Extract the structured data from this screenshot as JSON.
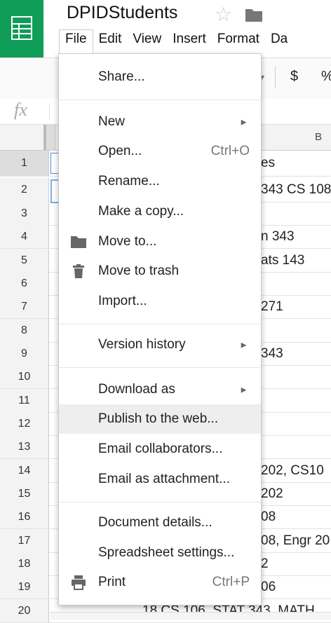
{
  "app": {
    "title": "DPIDStudents"
  },
  "menubar": [
    "File",
    "Edit",
    "View",
    "Insert",
    "Format",
    "Da"
  ],
  "toolbar": {
    "currency": "$",
    "percent": "%"
  },
  "formula": {
    "label": "fx"
  },
  "columns": {
    "b": "B"
  },
  "rows": [
    {
      "num": "1",
      "text": "es"
    },
    {
      "num": "2",
      "text": "343 CS 108"
    },
    {
      "num": "3",
      "text": ""
    },
    {
      "num": "4",
      "text": "n 343"
    },
    {
      "num": "5",
      "text": "ats 143"
    },
    {
      "num": "6",
      "text": ""
    },
    {
      "num": "7",
      "text": "271"
    },
    {
      "num": "8",
      "text": ""
    },
    {
      "num": "9",
      "text": "343"
    },
    {
      "num": "10",
      "text": ""
    },
    {
      "num": "11",
      "text": ""
    },
    {
      "num": "12",
      "text": ""
    },
    {
      "num": "13",
      "text": ""
    },
    {
      "num": "14",
      "text": "202, CS10"
    },
    {
      "num": "15",
      "text": "202"
    },
    {
      "num": "16",
      "text": "08"
    },
    {
      "num": "17",
      "text": "08, Engr 20"
    },
    {
      "num": "18",
      "text": "2"
    },
    {
      "num": "19",
      "text": "06"
    },
    {
      "num": "20",
      "text": "18 CS 106, STAT 343, MATH"
    }
  ],
  "file_menu": {
    "share": "Share...",
    "new": "New",
    "open": "Open...",
    "open_shortcut": "Ctrl+O",
    "rename": "Rename...",
    "make_copy": "Make a copy...",
    "move_to": "Move to...",
    "move_to_trash": "Move to trash",
    "import": "Import...",
    "version_history": "Version history",
    "download_as": "Download as",
    "publish": "Publish to the web...",
    "email_collaborators": "Email collaborators...",
    "email_attachment": "Email as attachment...",
    "document_details": "Document details...",
    "spreadsheet_settings": "Spreadsheet settings...",
    "print": "Print",
    "print_shortcut": "Ctrl+P",
    "submenu_arrow": "►"
  },
  "colors": {
    "accent": "#0f9d58",
    "selection": "#4a89dc"
  }
}
